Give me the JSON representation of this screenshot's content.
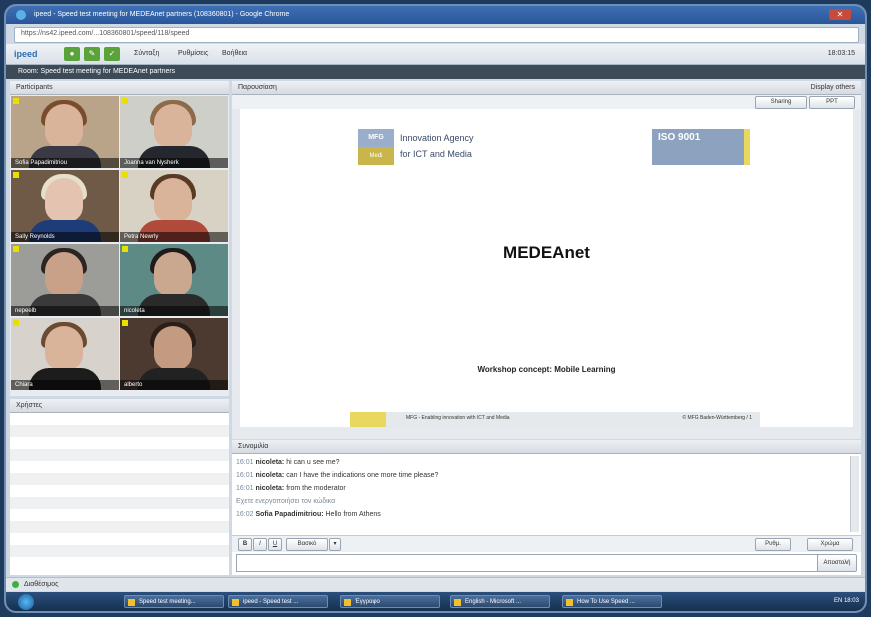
{
  "window": {
    "title": "ipeed - Speed test meeting for MEDEAnet partners (108360801) - Google Chrome",
    "close_glyph": "✕"
  },
  "browser": {
    "url": "https://ns42.ipeed.com/...108360801/speed/118/speed"
  },
  "toolbar": {
    "logo": "ipeed",
    "menu": [
      "Σύνταξη",
      "Ρυθμίσεις",
      "Βοήθεια"
    ],
    "clock": "18:03:15"
  },
  "room": {
    "label": "Room: Speed test meeting for MEDEAnet partners"
  },
  "participants": {
    "header": "Participants",
    "tiles": [
      {
        "name": "Sofia Papadimitriou"
      },
      {
        "name": "Joanna van Nysherk"
      },
      {
        "name": "Sally Reynolds"
      },
      {
        "name": "Petra Newrly"
      },
      {
        "name": "nepeelb"
      },
      {
        "name": "nicoleta"
      },
      {
        "name": "Chiara"
      },
      {
        "name": "alberto"
      }
    ]
  },
  "users": {
    "header": "Χρήστες"
  },
  "presentation": {
    "header": "Παρουσίαση",
    "display_label": "Display others",
    "btn_sharing": "Sharing",
    "btn_ppt": "PPT",
    "slide": {
      "logo_box_top": "MFG",
      "logo_box_bottom": "Medi",
      "agency_line1": "Innovation Agency",
      "agency_line2": "for ICT and Media",
      "iso_label": "ISO 9001",
      "title": "MEDEAnet",
      "subtitle": "Workshop concept: Mobile Learning",
      "footer_left": "MFG - Enabling innovation with ICT and Media",
      "footer_right": "© MFG Baden-Württemberg  /  1"
    }
  },
  "chat": {
    "header": "Συνομιλία",
    "lines": [
      {
        "time": "16:01",
        "who": "nicoleta:",
        "text": "hi can u see me?"
      },
      {
        "time": "16:01",
        "who": "nicoleta:",
        "text": "can I have the indications one more time please?"
      },
      {
        "time": "16:01",
        "who": "nicoleta:",
        "text": "from the moderator"
      },
      {
        "system": "Εχετε ενεργοποιήσει τον κώδικα"
      },
      {
        "time": "16:02",
        "who": "Sofia Papadimitriou:",
        "text": "Hello from Athens"
      }
    ],
    "fmt_bold": "B",
    "fmt_italic": "I",
    "fmt_underline": "U",
    "font_select": "Βασικό",
    "send_label": "Αποστολή",
    "right_select1": "Ρυθμ.",
    "right_select2": "Χρώμα"
  },
  "status": {
    "text": "Διαθέσιμος"
  },
  "taskbar": {
    "items": [
      "Speed test meeting...",
      "ipeed - Speed test ...",
      "Έγγραφο",
      "English - Microsoft ...",
      "How To Use Speed ..."
    ],
    "tray": "EN  18:03"
  }
}
